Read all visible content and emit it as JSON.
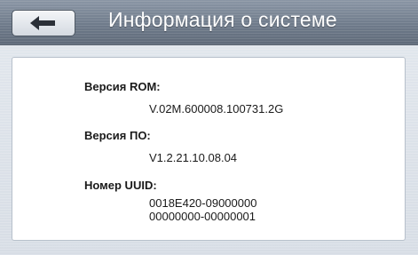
{
  "header": {
    "title": "Информация о системе",
    "back_icon": "left-arrow-icon"
  },
  "info": {
    "rom_label": "Версия ROM:",
    "rom_value": "V.02M.600008.100731.2G",
    "software_label": "Версия ПО:",
    "software_value": "V1.2.21.10.08.04",
    "uuid_label": "Номер UUID:",
    "uuid_line1": "0018E420-09000000",
    "uuid_line2": "00000000-00000001"
  },
  "colors": {
    "header_top": "#8b96a5",
    "header_bottom": "#5f6a79",
    "background": "#dde3ea",
    "panel": "#ffffff",
    "text": "#1a1a1a"
  }
}
